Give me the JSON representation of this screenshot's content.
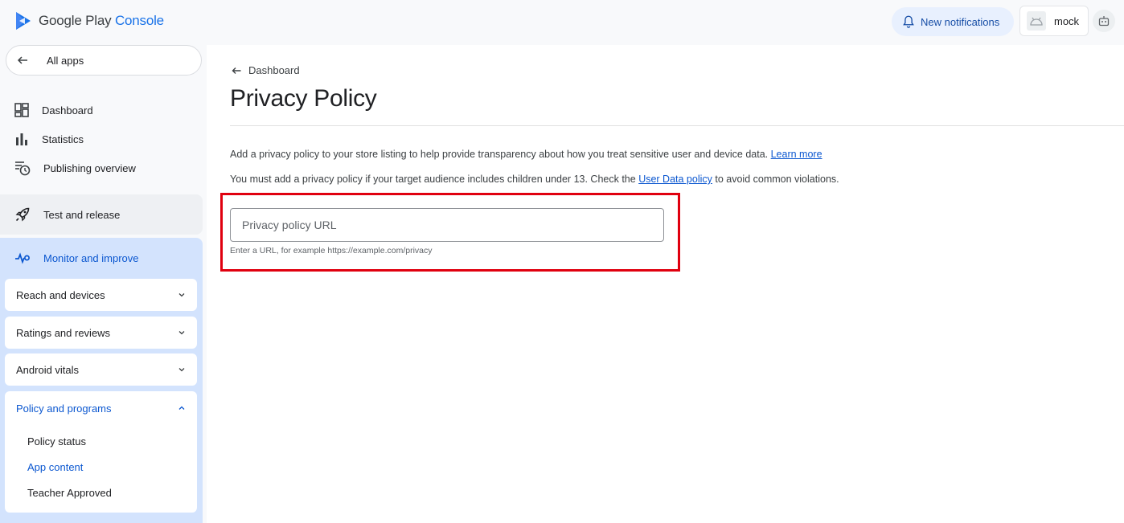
{
  "header": {
    "logo_text_main": "Google Play ",
    "logo_text_accent": "Console",
    "notifications_label": "New notifications",
    "account_name": "mock"
  },
  "sidebar": {
    "all_apps": "All apps",
    "items": [
      {
        "label": "Dashboard",
        "icon": "dashboard-icon"
      },
      {
        "label": "Statistics",
        "icon": "bar-chart-icon"
      },
      {
        "label": "Publishing overview",
        "icon": "publishing-icon"
      }
    ],
    "test_release": "Test and release",
    "monitor": {
      "label": "Monitor and improve",
      "groups": [
        {
          "label": "Reach and devices"
        },
        {
          "label": "Ratings and reviews"
        },
        {
          "label": "Android vitals"
        }
      ],
      "policy": {
        "label": "Policy and programs",
        "children": [
          {
            "label": "Policy status",
            "active": false
          },
          {
            "label": "App content",
            "active": true
          },
          {
            "label": "Teacher Approved",
            "active": false
          }
        ]
      }
    }
  },
  "main": {
    "breadcrumb": "Dashboard",
    "title": "Privacy Policy",
    "desc1": "Add a privacy policy to your store listing to help provide transparency about how you treat sensitive user and device data.",
    "desc1_link": "Learn more",
    "desc2_before": "You must add a privacy policy if your target audience includes children under 13. Check the",
    "desc2_link": "User Data policy",
    "desc2_after": "to avoid common violations.",
    "url_input": {
      "placeholder": "Privacy policy URL",
      "value": "",
      "helper": "Enter a URL, for example https://example.com/privacy"
    }
  },
  "colors": {
    "accent": "#0b57d0",
    "highlight": "#e0000f",
    "monitor_bg": "#d3e3fd"
  }
}
